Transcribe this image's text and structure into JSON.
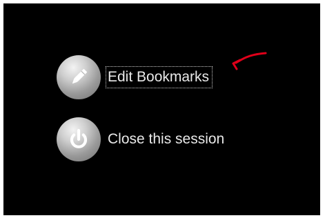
{
  "menu": {
    "items": [
      {
        "label": "Edit Bookmarks",
        "icon": "pencil-icon",
        "focused": true
      },
      {
        "label": "Close this session",
        "icon": "power-icon",
        "focused": false
      }
    ]
  },
  "colors": {
    "background": "#000000",
    "label_text": "#e9e9e9",
    "annotation_arrow": "#e0001a"
  }
}
